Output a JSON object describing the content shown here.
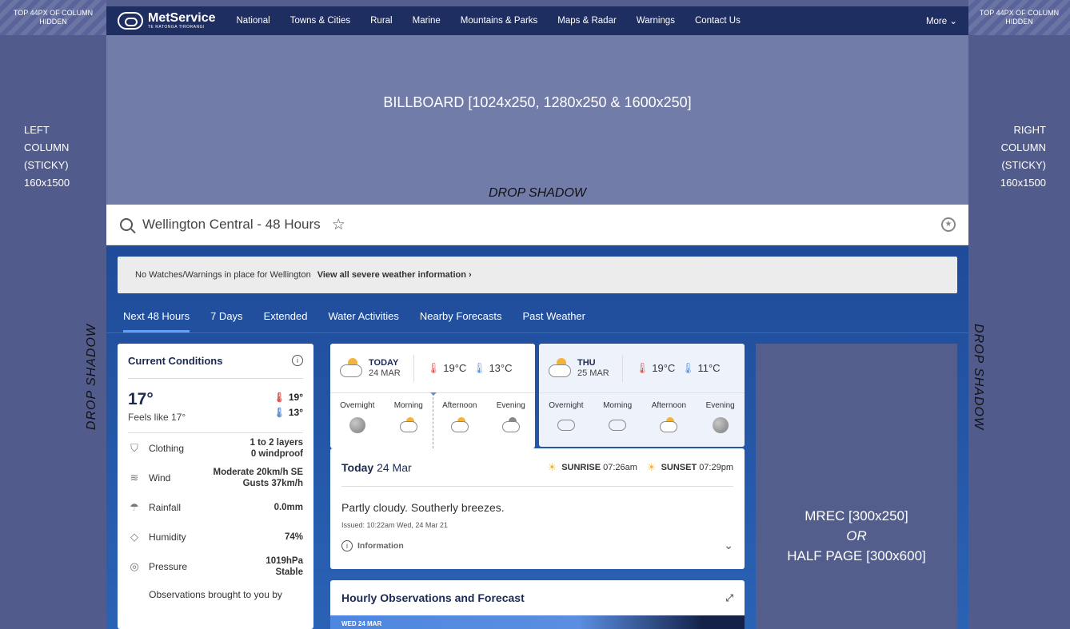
{
  "left_column": {
    "hidden_label": "TOP 44PX OF COLUMN HIDDEN",
    "label_lines": [
      "LEFT",
      "COLUMN",
      "(STICKY)",
      "160x1500"
    ],
    "drop_shadow": "DROP SHADOW"
  },
  "right_column": {
    "hidden_label": "TOP 44PX OF COLUMN HIDDEN",
    "label_lines": [
      "RIGHT",
      "COLUMN",
      "(STICKY)",
      "160x1500"
    ],
    "drop_shadow": "DROP SHADOW"
  },
  "nav": {
    "brand": "MetService",
    "brand_sub": "TE RATONGA TIRORANGI",
    "items": [
      "National",
      "Towns & Cities",
      "Rural",
      "Marine",
      "Mountains & Parks",
      "Maps & Radar",
      "Warnings",
      "Contact Us"
    ],
    "more": "More ⌄"
  },
  "billboard": {
    "label": "BILLBOARD [1024x250, 1280x250 & 1600x250]",
    "drop_shadow": "DROP SHADOW"
  },
  "search": {
    "location": "Wellington Central - 48 Hours"
  },
  "warning": {
    "text": "No Watches/Warnings in place for Wellington",
    "link": "View all severe weather information  ›"
  },
  "tabs": [
    "Next 48 Hours",
    "7 Days",
    "Extended",
    "Water Activities",
    "Nearby Forecasts",
    "Past Weather"
  ],
  "current": {
    "title": "Current Conditions",
    "temp": "17°",
    "feels": "Feels like 17°",
    "high": "19°",
    "low": "13°",
    "rows": [
      {
        "label": "Clothing",
        "icon": "shirt-icon",
        "glyph": "⛉",
        "value_lines": [
          "1 to 2 layers",
          "0 windproof"
        ]
      },
      {
        "label": "Wind",
        "icon": "wind-icon",
        "glyph": "≋",
        "value_lines": [
          "Moderate 20km/h SE",
          "Gusts 37km/h"
        ]
      },
      {
        "label": "Rainfall",
        "icon": "umbrella-icon",
        "glyph": "☂",
        "value_lines": [
          "0.0mm"
        ]
      },
      {
        "label": "Humidity",
        "icon": "drop-icon",
        "glyph": "◇",
        "value_lines": [
          "74%"
        ]
      },
      {
        "label": "Pressure",
        "icon": "gauge-icon",
        "glyph": "◎",
        "value_lines": [
          "1019hPa",
          "Stable"
        ]
      }
    ],
    "footer": "Observations brought to you by"
  },
  "days": [
    {
      "day": "TODAY",
      "date": "24 MAR",
      "high": "19°C",
      "low": "13°C",
      "periods": [
        {
          "name": "Overnight",
          "icon": "moon"
        },
        {
          "name": "Morning",
          "icon": "cloudsun"
        },
        {
          "name": "Afternoon",
          "icon": "cloudsun"
        },
        {
          "name": "Evening",
          "icon": "cloudmoon"
        }
      ]
    },
    {
      "day": "THU",
      "date": "25 MAR",
      "high": "19°C",
      "low": "11°C",
      "periods": [
        {
          "name": "Overnight",
          "icon": "cloud"
        },
        {
          "name": "Morning",
          "icon": "cloud"
        },
        {
          "name": "Afternoon",
          "icon": "cloudsun"
        },
        {
          "name": "Evening",
          "icon": "moon"
        }
      ]
    }
  ],
  "today": {
    "title_bold": "Today",
    "title_date": "24 Mar",
    "sunrise_label": "SUNRISE",
    "sunrise": "07:26am",
    "sunset_label": "SUNSET",
    "sunset": "07:29pm",
    "description": "Partly cloudy. Southerly breezes.",
    "issued": "Issued: 10:22am Wed, 24 Mar 21",
    "info_label": "Information"
  },
  "hourly": {
    "title": "Hourly Observations and Forecast",
    "strip_label": "WED 24 MAR"
  },
  "mrec": {
    "line1": "MREC [300x250]",
    "line2": "OR",
    "line3": "HALF PAGE [300x600]"
  },
  "colors": {
    "nav_bg": "#1e2e61",
    "ad_placeholder": "#727ca9",
    "side_columns": "#525c8c",
    "main_bg": "#1f4b99",
    "accent_tab": "#5aa0ff"
  }
}
